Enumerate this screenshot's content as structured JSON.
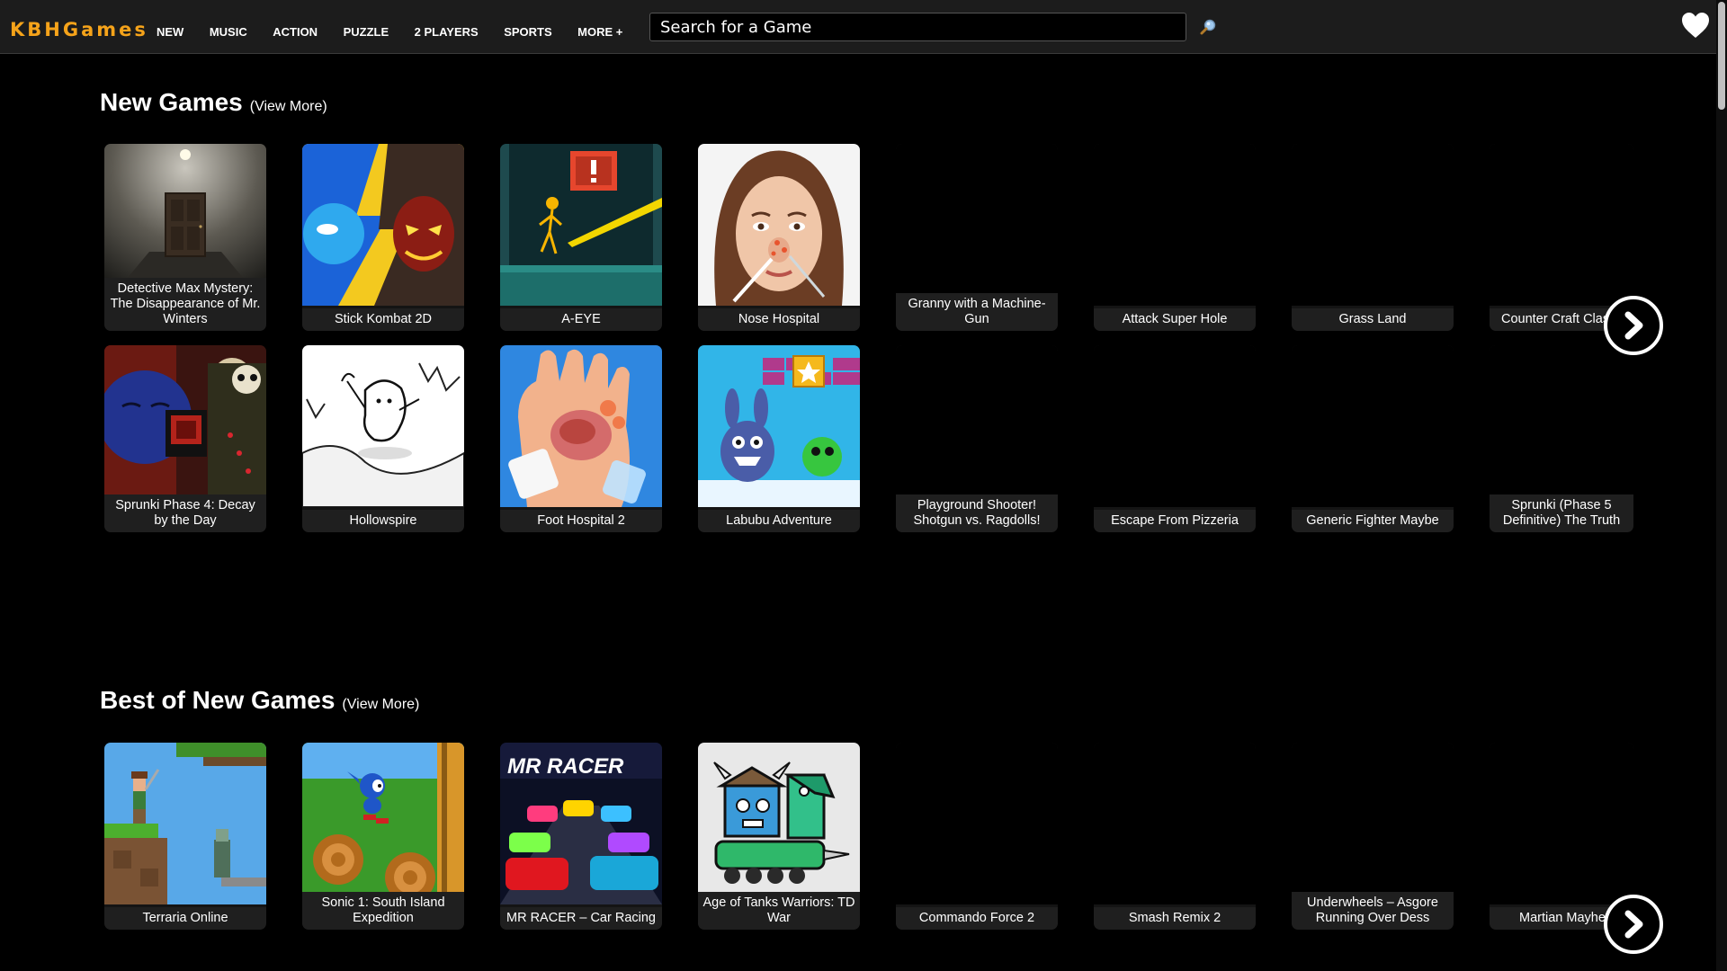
{
  "header": {
    "logo": "KBHGames",
    "nav": [
      "NEW",
      "MUSIC",
      "ACTION",
      "PUZZLE",
      "2 PLAYERS",
      "SPORTS",
      "MORE +"
    ],
    "search_placeholder": "Search for a Game",
    "search_icon": "magnifier-icon",
    "favorites_icon": "heart-icon"
  },
  "new_games": {
    "title": "New Games",
    "view_more": "(View More)",
    "games": [
      "Detective Max Mystery: The Disappearance of Mr. Winters",
      "Stick Kombat 2D",
      "A-EYE",
      "Nose Hospital",
      "Granny with a Machine-Gun",
      "Attack Super Hole",
      "Grass Land",
      "Counter Craft Clas",
      "Sprunki Phase 4: Decay by the Day",
      "Hollowspire",
      "Foot Hospital 2",
      "Labubu Adventure",
      "Playground Shooter! Shotgun vs. Ragdolls!",
      "Escape From Pizzeria",
      "Generic Fighter Maybe",
      "Sprunki (Phase 5 Definitive) The Truth"
    ],
    "next_icon": "chevron-right-icon"
  },
  "best_new_games": {
    "title": "Best of New Games",
    "view_more": "(View More)",
    "games": [
      "Terraria Online",
      "Sonic 1: South Island Expedition",
      "MR RACER – Car Racing",
      "Age of Tanks Warriors: TD War",
      "Commando Force 2",
      "Smash Remix 2",
      "Underwheels – Asgore Running Over Dess",
      "Martian Mayhe"
    ],
    "thumb_text_mr_racer": "MR RACER",
    "next_icon": "chevron-right-icon"
  },
  "colors": {
    "logo": "#f5a31a",
    "header_bg": "#1c1c1c",
    "card_label_bg": "#1f1f1f"
  }
}
